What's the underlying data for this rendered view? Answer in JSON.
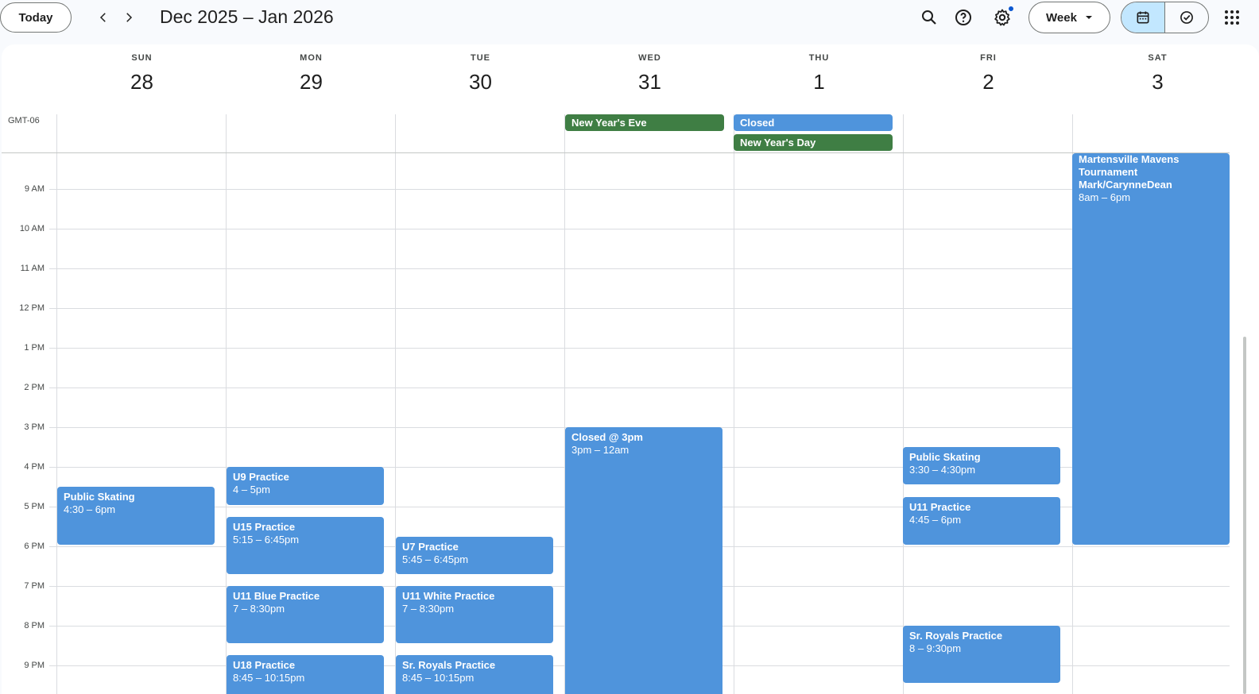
{
  "header": {
    "today_label": "Today",
    "date_range": "Dec 2025 – Jan 2026",
    "view_label": "Week"
  },
  "days": [
    {
      "dow": "SUN",
      "num": "28"
    },
    {
      "dow": "MON",
      "num": "29"
    },
    {
      "dow": "TUE",
      "num": "30"
    },
    {
      "dow": "WED",
      "num": "31"
    },
    {
      "dow": "THU",
      "num": "1"
    },
    {
      "dow": "FRI",
      "num": "2"
    },
    {
      "dow": "SAT",
      "num": "3"
    }
  ],
  "timezone": "GMT-06",
  "hours": [
    "9 AM",
    "10 AM",
    "11 AM",
    "12 PM",
    "1 PM",
    "2 PM",
    "3 PM",
    "4 PM",
    "5 PM",
    "6 PM",
    "7 PM",
    "8 PM",
    "9 PM"
  ],
  "allday_events": [
    {
      "title": "New Year's Eve",
      "color": "#3f7e44"
    },
    {
      "title": "Closed",
      "color": "#4f94dc"
    },
    {
      "title": "New Year's Day",
      "color": "#3f7e44"
    }
  ],
  "events": [
    {
      "title": "Public Skating",
      "time": "4:30 – 6pm"
    },
    {
      "title": "U9 Practice",
      "time": "4 – 5pm"
    },
    {
      "title": "U15 Practice",
      "time": "5:15 – 6:45pm"
    },
    {
      "title": "U11 Blue Practice",
      "time": "7 – 8:30pm"
    },
    {
      "title": "U18 Practice",
      "time": "8:45 – 10:15pm"
    },
    {
      "title": "U7 Practice",
      "time": "5:45 – 6:45pm"
    },
    {
      "title": "U11 White Practice",
      "time": "7 – 8:30pm"
    },
    {
      "title": "Sr. Royals Practice",
      "time": "8:45 – 10:15pm"
    },
    {
      "title": "Closed @ 3pm",
      "time": "3pm – 12am"
    },
    {
      "title": "Public Skating",
      "time": "3:30 – 4:30pm"
    },
    {
      "title": "U11 Practice",
      "time": "4:45 – 6pm"
    },
    {
      "title": "Sr. Royals Practice",
      "time": "8 – 9:30pm"
    },
    {
      "title": "Martensville Mavens Tournament Mark/CarynneDean",
      "time": "8am – 6pm"
    }
  ],
  "colors": {
    "event_blue": "#4f94dc",
    "holiday_green": "#3f7e44",
    "selected_view": "#c2e7ff",
    "notification_dot": "#0b57d0"
  }
}
